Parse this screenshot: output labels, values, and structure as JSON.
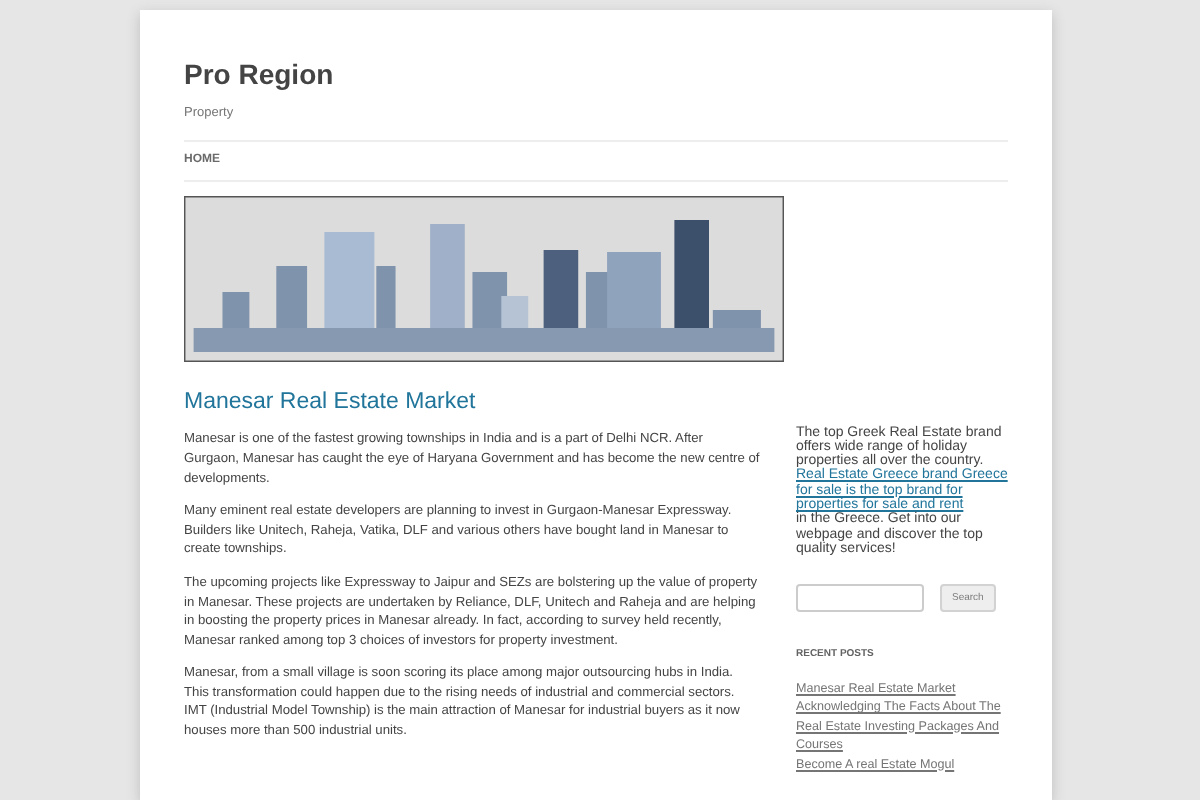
{
  "site": {
    "title": "Pro Region",
    "tagline": "Property"
  },
  "nav": [
    {
      "label": "HOME"
    }
  ],
  "post": {
    "title": "Manesar Real Estate Market",
    "paragraphs": [
      "Manesar is one of the fastest growing townships in India and is a part of Delhi NCR. After Gurgaon, Manesar has caught the eye of Haryana Government and has become the new centre of developments.",
      "Many eminent real estate developers are planning to invest in Gurgaon-Manesar Expressway. Builders like Unitech, Raheja, Vatika, DLF and various others have bought land in Manesar to create townships.",
      "The upcoming projects like Expressway to Jaipur and SEZs are bolstering up the value of property in Manesar. These projects are undertaken by Reliance, DLF, Unitech and Raheja and are helping in boosting the property prices in Manesar already. In fact, according to survey held recently, Manesar ranked among top 3 choices of investors for property investment.",
      "Manesar, from a small village is soon scoring its place among major outsourcing hubs in India. This transformation could happen due to the rising needs of industrial and commercial sectors. IMT (Industrial Model Township) is the main attraction of Manesar for industrial buyers as it now houses more than 500 industrial units."
    ]
  },
  "sidebar": {
    "promo": {
      "before": "The top Greek Real Estate brand offers wide range of holiday properties all over the country.",
      "link": "Real Estate Greece brand Greece for sale is the top brand for properties for sale and rent",
      "after": "in the Greece. Get into our webpage and discover the top quality services!"
    },
    "search": {
      "button": "Search"
    },
    "recent_posts": {
      "heading": "RECENT POSTS",
      "items": [
        "Manesar Real Estate Market",
        "Acknowledging The Facts About The Real Estate Investing Packages And Courses",
        "Become A real Estate Mogul"
      ]
    }
  }
}
